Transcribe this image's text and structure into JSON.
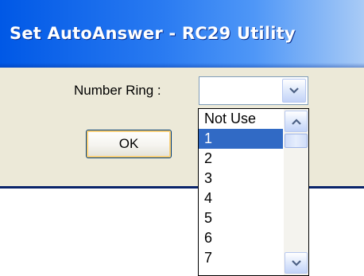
{
  "window": {
    "title": "Set AutoAnswer - RC29 Utility"
  },
  "form": {
    "number_ring_label": "Number Ring :",
    "combo_value": "",
    "ok_label": "OK"
  },
  "dropdown": {
    "items": [
      "Not Use",
      "1",
      "2",
      "3",
      "4",
      "5",
      "6",
      "7"
    ],
    "selected_index": 1
  },
  "icons": {
    "combo_arrow": "chevron-down-icon",
    "scroll_up": "chevron-up-icon",
    "scroll_down": "chevron-down-icon"
  },
  "colors": {
    "titlebar": "#0058e6",
    "selection": "#316ac5",
    "dialog_face": "#ece9d8"
  }
}
